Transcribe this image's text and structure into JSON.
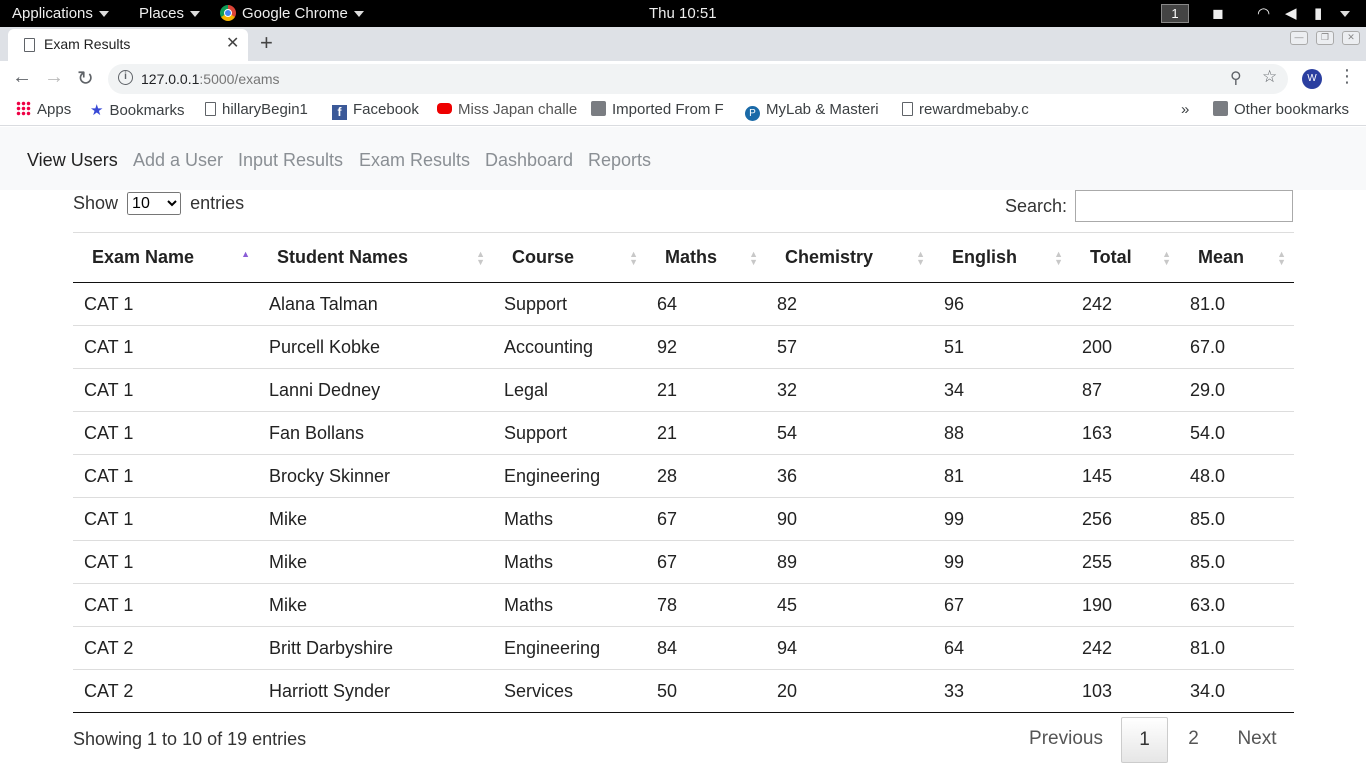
{
  "system_bar": {
    "applications": "Applications",
    "places": "Places",
    "app": "Google Chrome",
    "clock": "Thu 10:51",
    "workspace": "1"
  },
  "browser": {
    "tab_title": "Exam Results",
    "url_host": "127.0.0.1",
    "url_rest": ":5000/exams",
    "profile_initial": "W",
    "bookmarks": [
      "Apps",
      "Bookmarks",
      "hillaryBegin1",
      "Facebook",
      "Miss Japan challe",
      "Imported From F",
      "MyLab & Masteri",
      "rewardmebaby.c",
      "Other bookmarks"
    ],
    "overflow": "»"
  },
  "nav": {
    "items": [
      "View Users",
      "Add a User",
      "Input Results",
      "Exam Results",
      "Dashboard",
      "Reports"
    ]
  },
  "datatable": {
    "show_label": "Show",
    "entries_label": "entries",
    "page_length": "10",
    "search_label": "Search:",
    "columns": [
      "Exam Name",
      "Student Names",
      "Course",
      "Maths",
      "Chemistry",
      "English",
      "Total",
      "Mean"
    ],
    "rows": [
      [
        "CAT 1",
        "Alana Talman",
        "Support",
        "64",
        "82",
        "96",
        "242",
        "81.0"
      ],
      [
        "CAT 1",
        "Purcell Kobke",
        "Accounting",
        "92",
        "57",
        "51",
        "200",
        "67.0"
      ],
      [
        "CAT 1",
        "Lanni Dedney",
        "Legal",
        "21",
        "32",
        "34",
        "87",
        "29.0"
      ],
      [
        "CAT 1",
        "Fan Bollans",
        "Support",
        "21",
        "54",
        "88",
        "163",
        "54.0"
      ],
      [
        "CAT 1",
        "Brocky Skinner",
        "Engineering",
        "28",
        "36",
        "81",
        "145",
        "48.0"
      ],
      [
        "CAT 1",
        "Mike",
        "Maths",
        "67",
        "90",
        "99",
        "256",
        "85.0"
      ],
      [
        "CAT 1",
        "Mike",
        "Maths",
        "67",
        "89",
        "99",
        "255",
        "85.0"
      ],
      [
        "CAT 1",
        "Mike",
        "Maths",
        "78",
        "45",
        "67",
        "190",
        "63.0"
      ],
      [
        "CAT 2",
        "Britt Darbyshire",
        "Engineering",
        "84",
        "94",
        "64",
        "242",
        "81.0"
      ],
      [
        "CAT 2",
        "Harriott Synder",
        "Services",
        "50",
        "20",
        "33",
        "103",
        "34.0"
      ]
    ],
    "info": "Showing 1 to 10 of 19 entries",
    "pagination": {
      "previous": "Previous",
      "pages": [
        "1",
        "2"
      ],
      "next": "Next"
    }
  },
  "colors": {
    "sort_active": "#8a5cd6",
    "nav_active": "#222222",
    "nav_inactive": "#8a8f94"
  }
}
